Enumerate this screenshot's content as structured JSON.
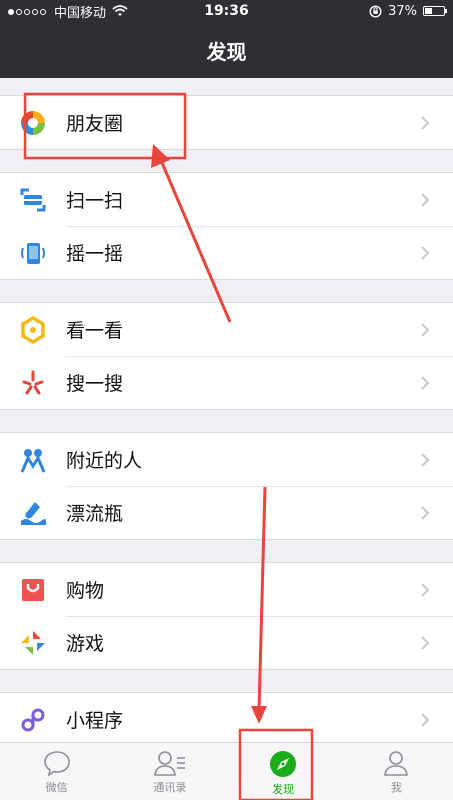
{
  "status": {
    "carrier": "中国移动",
    "time": "19:36",
    "battery": "37%",
    "battery_level": 0.37,
    "signal_bars_on": 1,
    "signal_bars_total": 5
  },
  "nav": {
    "title": "发现"
  },
  "groups": [
    [
      {
        "label": "朋友圈",
        "icon": "moments-icon"
      }
    ],
    [
      {
        "label": "扫一扫",
        "icon": "scan-icon"
      },
      {
        "label": "摇一摇",
        "icon": "shake-icon"
      }
    ],
    [
      {
        "label": "看一看",
        "icon": "top-stories-icon"
      },
      {
        "label": "搜一搜",
        "icon": "search-icon"
      }
    ],
    [
      {
        "label": "附近的人",
        "icon": "people-nearby-icon"
      },
      {
        "label": "漂流瓶",
        "icon": "drift-bottle-icon"
      }
    ],
    [
      {
        "label": "购物",
        "icon": "shopping-bag-icon"
      },
      {
        "label": "游戏",
        "icon": "games-icon"
      }
    ],
    [
      {
        "label": "小程序",
        "icon": "mini-program-icon"
      }
    ]
  ],
  "tabbar": [
    {
      "label": "微信",
      "icon": "chat-bubble-icon",
      "active": false
    },
    {
      "label": "通讯录",
      "icon": "contacts-icon",
      "active": false
    },
    {
      "label": "发现",
      "icon": "compass-icon",
      "active": true
    },
    {
      "label": "我",
      "icon": "profile-icon",
      "active": false
    }
  ],
  "colors": {
    "bar": "#2e2e33",
    "accent": "#1aad19",
    "annotation": "#e8453c",
    "background": "#efeff4"
  }
}
